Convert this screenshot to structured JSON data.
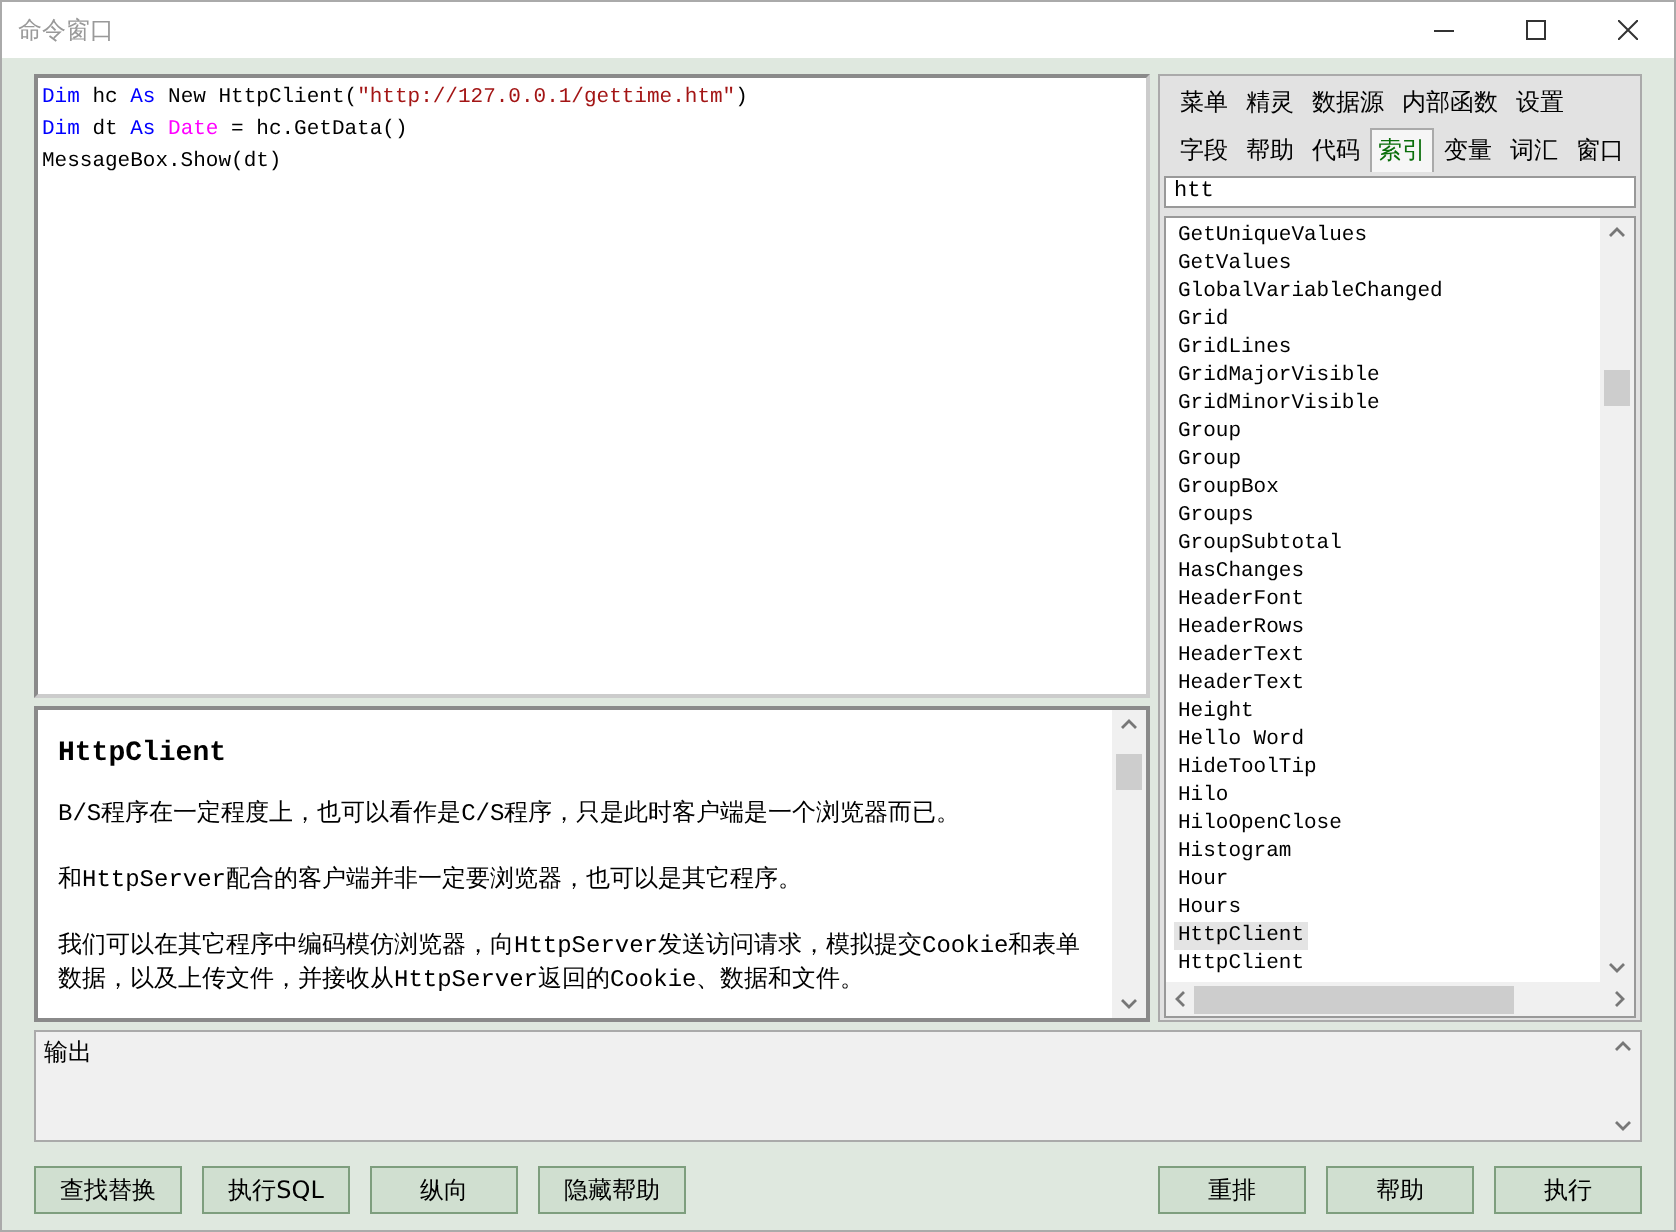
{
  "window": {
    "title": "命令窗口"
  },
  "editor": {
    "lines": [
      [
        {
          "kind": "keyword",
          "text": "Dim"
        },
        {
          "kind": "plain",
          "text": " hc "
        },
        {
          "kind": "keyword",
          "text": "As"
        },
        {
          "kind": "plain",
          "text": " New HttpClient("
        },
        {
          "kind": "string",
          "text": "\"http://127.0.0.1/gettime.htm\""
        },
        {
          "kind": "plain",
          "text": ")"
        }
      ],
      [
        {
          "kind": "keyword",
          "text": "Dim"
        },
        {
          "kind": "plain",
          "text": " dt "
        },
        {
          "kind": "keyword",
          "text": "As "
        },
        {
          "kind": "type",
          "text": "Date"
        },
        {
          "kind": "plain",
          "text": " = hc.GetData()"
        }
      ],
      [
        {
          "kind": "plain",
          "text": "MessageBox.Show(dt)"
        }
      ]
    ]
  },
  "help": {
    "title": "HttpClient",
    "paragraphs": [
      "B/S程序在一定程度上，也可以看作是C/S程序，只是此时客户端是一个浏览器而已。",
      "和HttpServer配合的客户端并非一定要浏览器，也可以是其它程序。",
      "我们可以在其它程序中编码模仿浏览器，向HttpServer发送访问请求，模拟提交Cookie和表单数据，以及上传文件，并接收从HttpServer返回的Cookie、数据和文件。"
    ]
  },
  "tab_rows": [
    [
      {
        "label": "菜单",
        "selected": false
      },
      {
        "label": "精灵",
        "selected": false
      },
      {
        "label": "数据源",
        "selected": false
      },
      {
        "label": "内部函数",
        "selected": false
      },
      {
        "label": "设置",
        "selected": false
      }
    ],
    [
      {
        "label": "字段",
        "selected": false
      },
      {
        "label": "帮助",
        "selected": false
      },
      {
        "label": "代码",
        "selected": false
      },
      {
        "label": "索引",
        "selected": true
      },
      {
        "label": "变量",
        "selected": false
      },
      {
        "label": "词汇",
        "selected": false
      },
      {
        "label": "窗口",
        "selected": false
      }
    ]
  ],
  "search": {
    "value": "htt"
  },
  "index_list": [
    {
      "label": "GetUniqueValues",
      "selected": false
    },
    {
      "label": "GetValues",
      "selected": false
    },
    {
      "label": "GlobalVariableChanged",
      "selected": false
    },
    {
      "label": "Grid",
      "selected": false
    },
    {
      "label": "GridLines",
      "selected": false
    },
    {
      "label": "GridMajorVisible",
      "selected": false
    },
    {
      "label": "GridMinorVisible",
      "selected": false
    },
    {
      "label": "Group",
      "selected": false
    },
    {
      "label": "Group",
      "selected": false
    },
    {
      "label": "GroupBox",
      "selected": false
    },
    {
      "label": "Groups",
      "selected": false
    },
    {
      "label": "GroupSubtotal",
      "selected": false
    },
    {
      "label": "HasChanges",
      "selected": false
    },
    {
      "label": "HeaderFont",
      "selected": false
    },
    {
      "label": "HeaderRows",
      "selected": false
    },
    {
      "label": "HeaderText",
      "selected": false
    },
    {
      "label": "HeaderText",
      "selected": false
    },
    {
      "label": "Height",
      "selected": false
    },
    {
      "label": "Hello Word",
      "selected": false
    },
    {
      "label": "HideToolTip",
      "selected": false
    },
    {
      "label": "Hilo",
      "selected": false
    },
    {
      "label": "HiloOpenClose",
      "selected": false
    },
    {
      "label": "Histogram",
      "selected": false
    },
    {
      "label": "Hour",
      "selected": false
    },
    {
      "label": "Hours",
      "selected": false
    },
    {
      "label": "HttpClient",
      "selected": true
    },
    {
      "label": "HttpClient",
      "selected": false
    }
  ],
  "output": {
    "text": "输出"
  },
  "left_buttons": [
    "查找替换",
    "执行SQL",
    "纵向",
    "隐藏帮助"
  ],
  "right_buttons": [
    "重排",
    "帮助",
    "执行"
  ]
}
